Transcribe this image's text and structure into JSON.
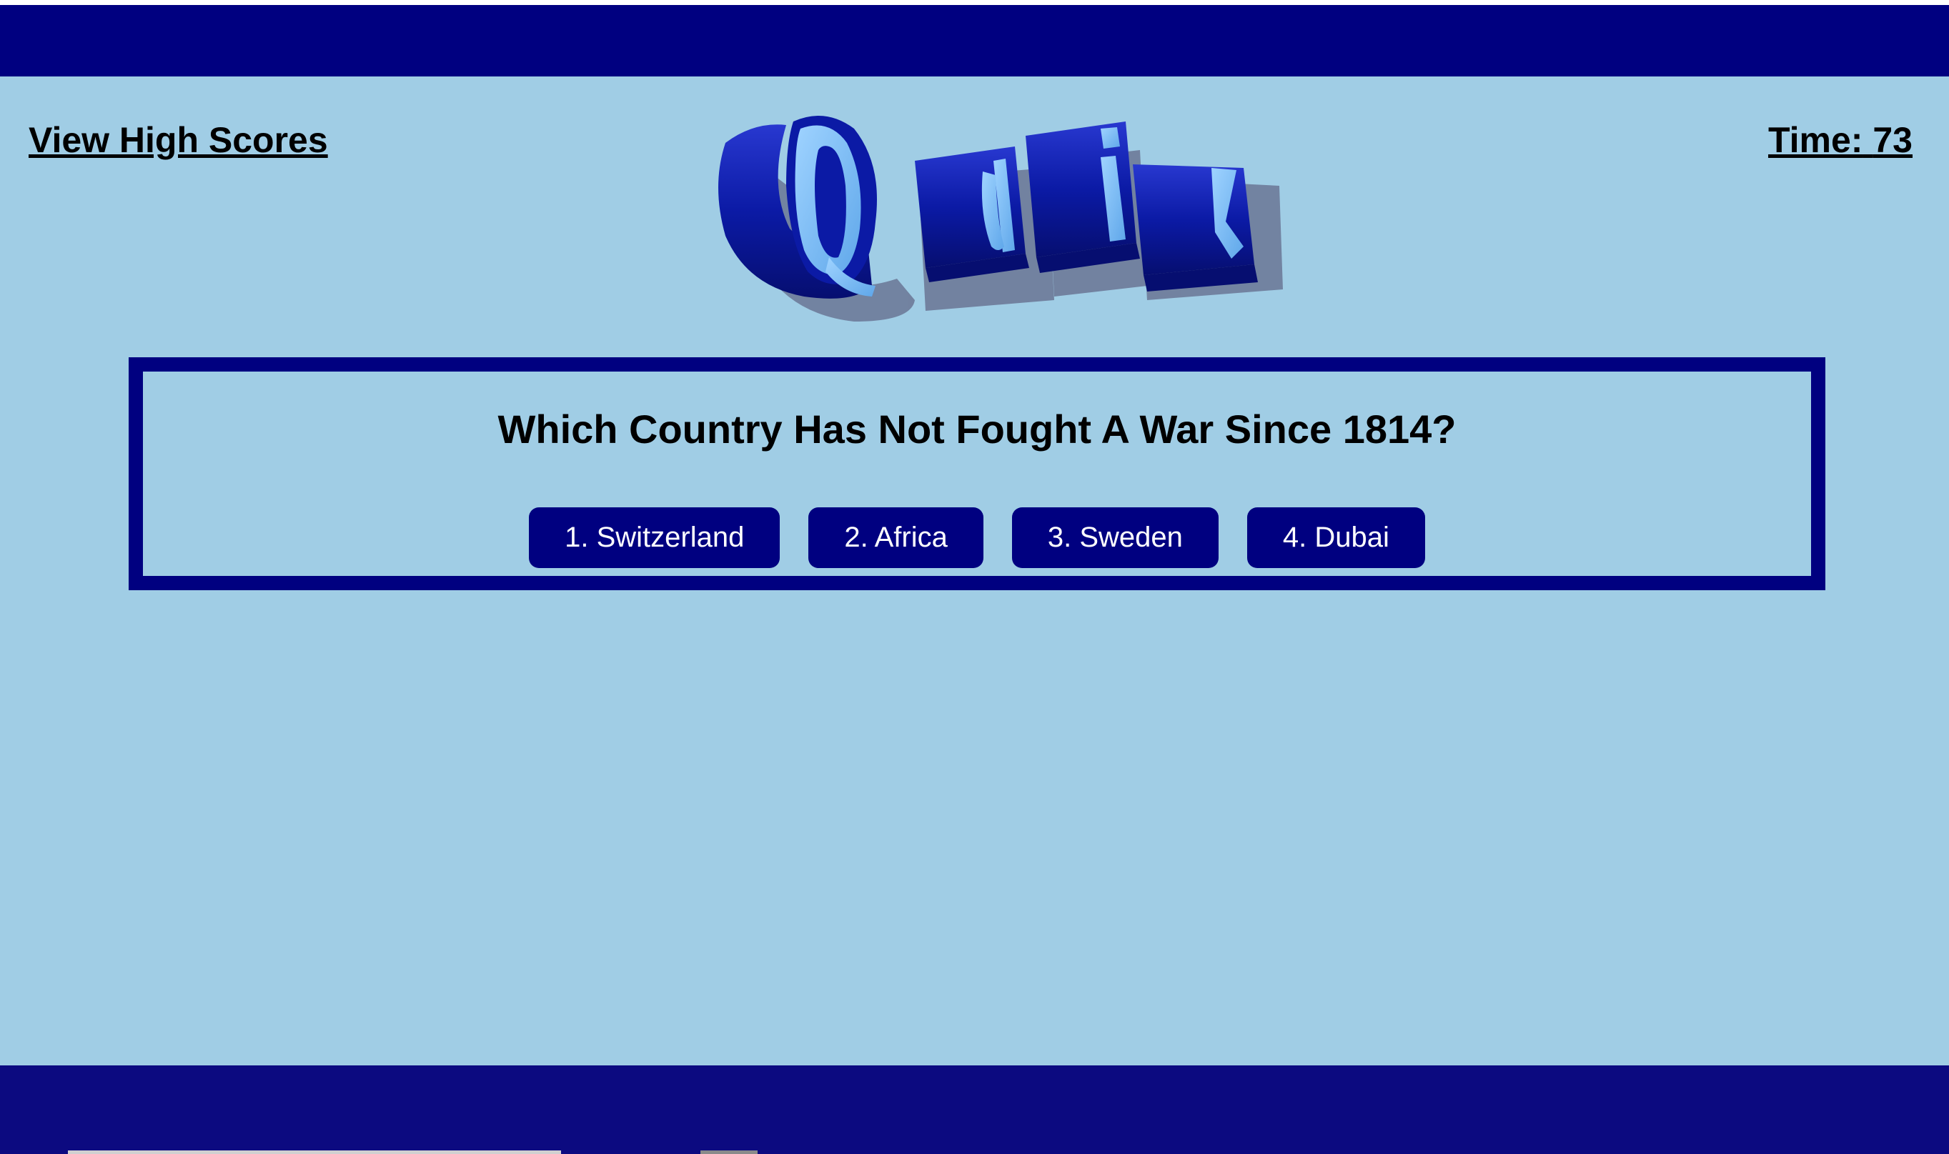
{
  "header": {
    "high_scores_label": "View High Scores",
    "timer_label": "Time:",
    "timer_value": "73"
  },
  "logo": {
    "text": "Quiz",
    "letters": [
      "Q",
      "u",
      "i",
      "z"
    ],
    "front_color": "#0a1aa8",
    "face_color": "#7ec0f5",
    "shadow_color": "#6a7595"
  },
  "quiz": {
    "question": "Which Country Has Not Fought A War Since 1814?",
    "answers": [
      {
        "label": "1. Switzerland"
      },
      {
        "label": "2. Africa"
      },
      {
        "label": "3. Sweden"
      },
      {
        "label": "4. Dubai"
      }
    ]
  },
  "colors": {
    "background": "#a0cde5",
    "header": "#000080",
    "footer": "#0c0a80",
    "button": "#000080",
    "button_text": "#ffffff"
  }
}
